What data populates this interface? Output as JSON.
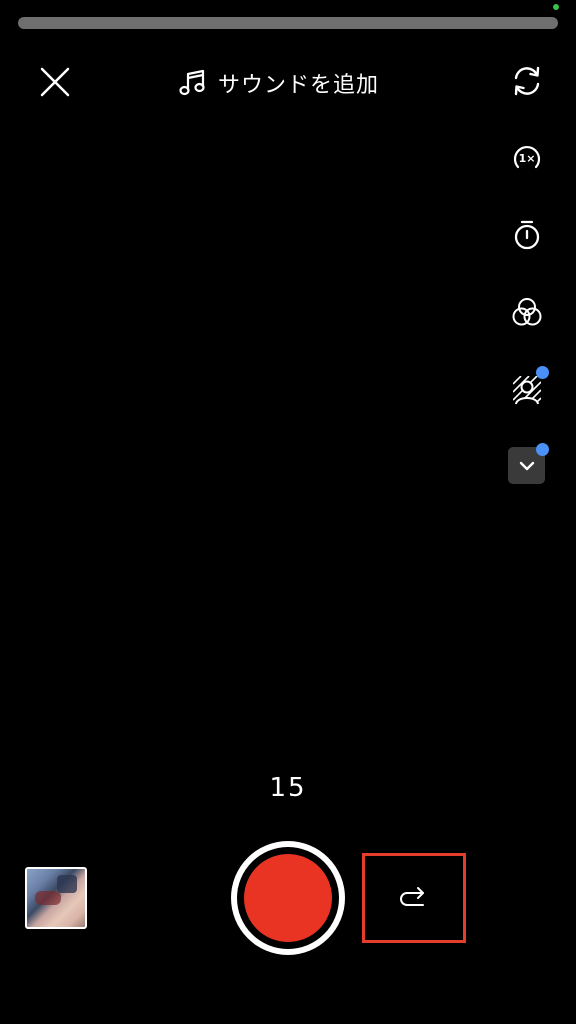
{
  "top_bar": {
    "sound_label": "サウンドを追加"
  },
  "side_tools": [
    {
      "name": "flip-camera-icon"
    },
    {
      "name": "speed-icon",
      "text": "1×"
    },
    {
      "name": "timer-icon"
    },
    {
      "name": "filters-icon"
    },
    {
      "name": "green-screen-icon",
      "has_badge": true
    },
    {
      "name": "chevron-down-icon",
      "has_badge": true
    }
  ],
  "record": {
    "duration": "15"
  },
  "colors": {
    "record_red": "#e93424",
    "badge_blue": "#4a90f7",
    "status_green": "#39c24a",
    "highlight_red": "#e53d2c"
  }
}
